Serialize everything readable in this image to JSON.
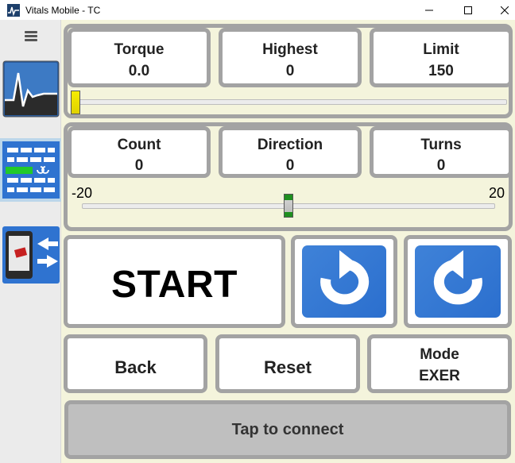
{
  "window": {
    "title": "Vitals Mobile - TC",
    "icons": [
      "app-icon",
      "minimize-icon",
      "maximize-icon",
      "close-icon"
    ]
  },
  "sidebar": {
    "items": [
      {
        "icon": "hamburger-menu-icon"
      },
      {
        "icon": "vitals-graph-icon"
      },
      {
        "icon": "turn-counter-icon",
        "selected": true
      },
      {
        "icon": "device-transfer-icon"
      }
    ]
  },
  "torque_panel": {
    "torque": {
      "label": "Torque",
      "value": "0.0"
    },
    "highest": {
      "label": "Highest",
      "value": "0"
    },
    "limit": {
      "label": "Limit",
      "value": "150"
    },
    "slider_value": 0
  },
  "count_panel": {
    "count": {
      "label": "Count",
      "value": "0"
    },
    "direction": {
      "label": "Direction",
      "value": "0"
    },
    "turns": {
      "label": "Turns",
      "value": "0"
    },
    "slider_min": "-20",
    "slider_max": "20",
    "slider_value": 0
  },
  "controls": {
    "start_label": "START",
    "rotate_icons": [
      "rotate-ccw-icon",
      "rotate-cw-icon"
    ]
  },
  "bottom": {
    "back_label": "Back",
    "reset_label": "Reset",
    "mode_label": "Mode",
    "mode_value": "EXER",
    "connect_label": "Tap to connect"
  },
  "colors": {
    "panel_bg": "#f4f4dc",
    "border": "#a3a3a3",
    "button_blue": "#2b6fce",
    "sidebar_selected": "#bcd6ea",
    "slider_thumb_torque": "#f0e000",
    "slider_thumb_count": "#1f8f1f"
  }
}
